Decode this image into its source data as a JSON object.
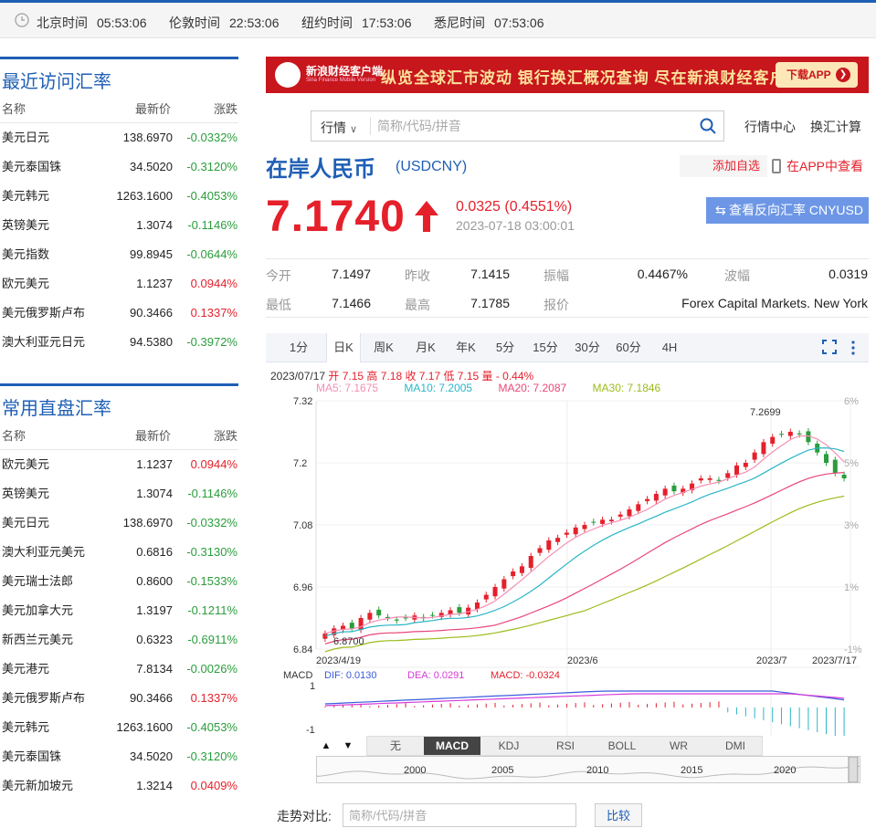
{
  "clocks": [
    {
      "label": "北京时间",
      "time": "05:53:06"
    },
    {
      "label": "伦敦时间",
      "time": "22:53:06"
    },
    {
      "label": "纽约时间",
      "time": "17:53:06"
    },
    {
      "label": "悉尼时间",
      "time": "07:53:06"
    }
  ],
  "recent": {
    "title": "最近访问汇率",
    "headers": [
      "名称",
      "最新价",
      "涨跌"
    ],
    "rows": [
      {
        "name": "美元日元",
        "price": "138.6970",
        "change": "-0.0332%"
      },
      {
        "name": "美元泰国铢",
        "price": "34.5020",
        "change": "-0.3120%"
      },
      {
        "name": "美元韩元",
        "price": "1263.1600",
        "change": "-0.4053%"
      },
      {
        "name": "英镑美元",
        "price": "1.3074",
        "change": "-0.1146%"
      },
      {
        "name": "美元指数",
        "price": "99.8945",
        "change": "-0.0644%"
      },
      {
        "name": "欧元美元",
        "price": "1.1237",
        "change": "0.0944%"
      },
      {
        "name": "美元俄罗斯卢布",
        "price": "90.3466",
        "change": "0.1337%"
      },
      {
        "name": "澳大利亚元日元",
        "price": "94.5380",
        "change": "-0.3972%"
      }
    ]
  },
  "common": {
    "title": "常用直盘汇率",
    "headers": [
      "名称",
      "最新价",
      "涨跌"
    ],
    "rows": [
      {
        "name": "欧元美元",
        "price": "1.1237",
        "change": "0.0944%"
      },
      {
        "name": "英镑美元",
        "price": "1.3074",
        "change": "-0.1146%"
      },
      {
        "name": "美元日元",
        "price": "138.6970",
        "change": "-0.0332%"
      },
      {
        "name": "澳大利亚元美元",
        "price": "0.6816",
        "change": "-0.3130%"
      },
      {
        "name": "美元瑞士法郎",
        "price": "0.8600",
        "change": "-0.1533%"
      },
      {
        "name": "美元加拿大元",
        "price": "1.3197",
        "change": "-0.1211%"
      },
      {
        "name": "新西兰元美元",
        "price": "0.6323",
        "change": "-0.6911%"
      },
      {
        "name": "美元港元",
        "price": "7.8134",
        "change": "-0.0026%"
      },
      {
        "name": "美元俄罗斯卢布",
        "price": "90.3466",
        "change": "0.1337%"
      },
      {
        "name": "美元韩元",
        "price": "1263.1600",
        "change": "-0.4053%"
      },
      {
        "name": "美元泰国铢",
        "price": "34.5020",
        "change": "-0.3120%"
      },
      {
        "name": "美元新加坡元",
        "price": "1.3214",
        "change": "0.0409%"
      }
    ]
  },
  "banner": {
    "app_name": "新浪财经客户端",
    "app_sub": "Sina Finance Mobile Version",
    "slogan": "纵览全球汇市波动  银行换汇概况查询  尽在新浪财经客户端",
    "download": "下载APP"
  },
  "search": {
    "type": "行情",
    "placeholder": "简称/代码/拼音"
  },
  "top_links": {
    "market_center": "行情中心",
    "fx_calc": "换汇计算"
  },
  "quote": {
    "name": "在岸人民币",
    "code": "(USDCNY)",
    "add_watch": "添加自选",
    "app_view": "在APP中查看",
    "price": "7.1740",
    "change": "0.0325 (0.4551%)",
    "timestamp": "2023-07-18 03:00:01",
    "reverse_btn": "查看反向汇率 CNYUSD"
  },
  "stats": {
    "open_label": "今开",
    "open": "7.1497",
    "prev_label": "昨收",
    "prev": "7.1415",
    "amp_label": "振幅",
    "amp": "0.4467%",
    "vol_label": "波幅",
    "vol": "0.0319",
    "low_label": "最低",
    "low": "7.1466",
    "high_label": "最高",
    "high": "7.1785",
    "source_label": "报价",
    "source": "Forex Capital Markets. New York"
  },
  "chart_tabs": [
    "1分",
    "日K",
    "周K",
    "月K",
    "年K",
    "5分",
    "15分",
    "30分",
    "60分",
    "4H"
  ],
  "chart_info": {
    "date": "2023/07/17",
    "ohlc": "开 7.15 高 7.18 收 7.17 低 7.15 量 - 0.44%",
    "ma5": "MA5: 7.1675",
    "ma10": "MA10: 7.2005",
    "ma20": "MA20: 7.2087",
    "ma30": "MA30: 7.1846"
  },
  "macd_info": {
    "label": "MACD",
    "dif": "DIF: 0.0130",
    "dea": "DEA: 0.0291",
    "macd": "MACD: -0.0324"
  },
  "indicator_tabs": [
    "无",
    "MACD",
    "KDJ",
    "RSI",
    "BOLL",
    "WR",
    "DMI"
  ],
  "mini_years": [
    "2000",
    "2005",
    "2010",
    "2015",
    "2020"
  ],
  "compare": {
    "label": "走势对比:",
    "placeholder": "简称/代码/拼音",
    "button": "比较"
  },
  "colors": {
    "brand": "#1f5fb5",
    "up": "#e5202b",
    "down": "#2a9d3c",
    "ma5": "#f58fb5",
    "ma10": "#2ab6c6",
    "ma20": "#e8467a",
    "ma30": "#9bbc1a"
  },
  "chart_data": {
    "type": "candlestick",
    "y_left_ticks": [
      "7.32",
      "7.2",
      "7.08",
      "6.96",
      "6.84"
    ],
    "y_right_ticks": [
      "6%",
      "5%",
      "3%",
      "1%",
      "-1%"
    ],
    "x_ticks": [
      "2023/4/19",
      "2023/6",
      "2023/7",
      "2023/7/17"
    ],
    "ylim": [
      6.84,
      7.32
    ],
    "max_label": "7.2699",
    "min_label": "6.8700",
    "close": [
      6.87,
      6.88,
      6.885,
      6.88,
      6.9,
      6.91,
      6.905,
      6.9,
      6.895,
      6.9,
      6.905,
      6.9,
      6.905,
      6.91,
      6.915,
      6.91,
      6.92,
      6.93,
      6.945,
      6.96,
      6.975,
      6.99,
      7.0,
      7.02,
      7.035,
      7.05,
      7.055,
      7.065,
      7.075,
      7.08,
      7.085,
      7.09,
      7.09,
      7.1,
      7.11,
      7.12,
      7.13,
      7.14,
      7.15,
      7.145,
      7.15,
      7.16,
      7.17,
      7.17,
      7.165,
      7.18,
      7.195,
      7.2,
      7.22,
      7.24,
      7.25,
      7.255,
      7.26,
      7.255,
      7.24,
      7.22,
      7.2,
      7.18,
      7.17
    ],
    "macd_labels": [
      "1",
      "-1"
    ]
  }
}
